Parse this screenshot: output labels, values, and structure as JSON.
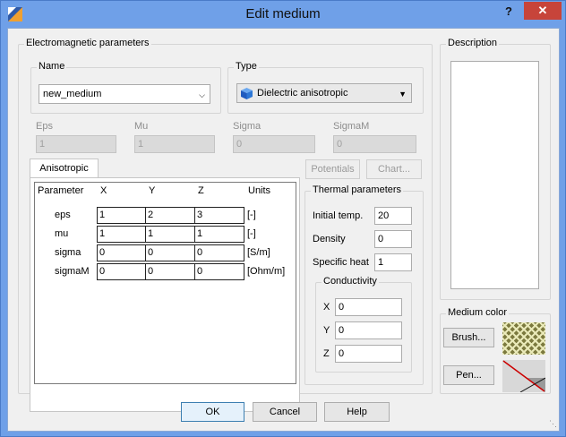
{
  "window": {
    "title": "Edit medium",
    "help": "?",
    "close": "✕",
    "icon": "app-icon"
  },
  "em": {
    "group_title": "Electromagnetic parameters",
    "name_label": "Name",
    "name_value": "new_medium",
    "type_label": "Type",
    "type_value": "Dielectric anisotropic",
    "eps_label": "Eps",
    "eps_value": "1",
    "mu_label": "Mu",
    "mu_value": "1",
    "sigma_label": "Sigma",
    "sigma_value": "0",
    "sigmam_label": "SigmaM",
    "sigmam_value": "0"
  },
  "tab": {
    "label": "Anisotropic"
  },
  "table": {
    "headers": [
      "Parameter",
      "X",
      "Y",
      "Z",
      "Units"
    ],
    "rows": [
      {
        "name": "eps",
        "x": "1",
        "y": "2",
        "z": "3",
        "unit": "[-]"
      },
      {
        "name": "mu",
        "x": "1",
        "y": "1",
        "z": "1",
        "unit": "[-]"
      },
      {
        "name": "sigma",
        "x": "0",
        "y": "0",
        "z": "0",
        "unit": "[S/m]"
      },
      {
        "name": "sigmaM",
        "x": "0",
        "y": "0",
        "z": "0",
        "unit": "[Ohm/m]"
      }
    ]
  },
  "buttons": {
    "potentials": "Potentials",
    "chart": "Chart...",
    "brush": "Brush...",
    "pen": "Pen...",
    "ok": "OK",
    "cancel": "Cancel",
    "help": "Help"
  },
  "thermal": {
    "group_title": "Thermal parameters",
    "initial_temp_label": "Initial temp.",
    "initial_temp_value": "20",
    "density_label": "Density",
    "density_value": "0",
    "specific_heat_label": "Specific heat",
    "specific_heat_value": "1",
    "conductivity_title": "Conductivity",
    "cx_label": "X",
    "cx_value": "0",
    "cy_label": "Y",
    "cy_value": "0",
    "cz_label": "Z",
    "cz_value": "0"
  },
  "description": {
    "group_title": "Description",
    "text": ""
  },
  "medium_color": {
    "group_title": "Medium color",
    "brush_color": "#7c7a3f",
    "pen_color": "#cc0000"
  }
}
